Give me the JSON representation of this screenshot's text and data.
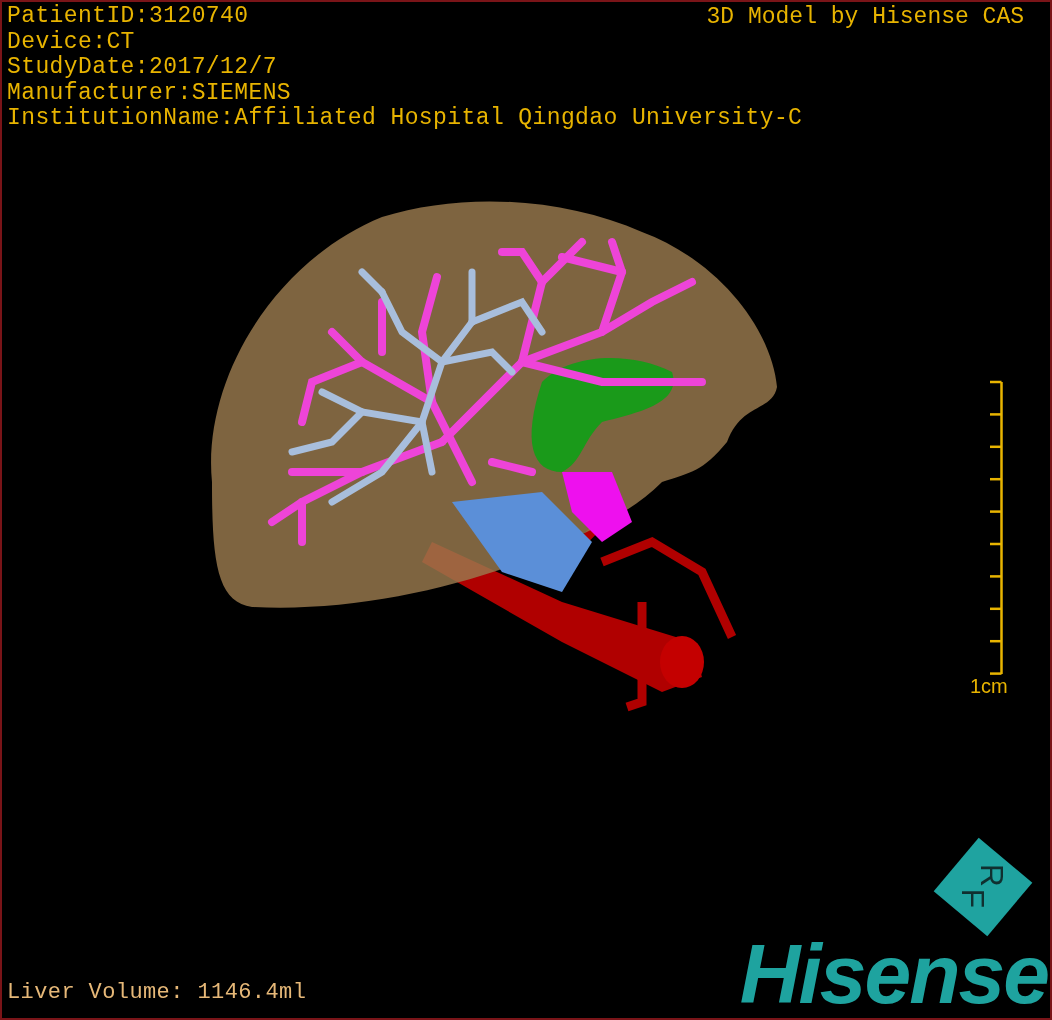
{
  "info_lines": [
    "PatientID:3120740",
    "Device:CT",
    "StudyDate:2017/12/7",
    "Manufacturer:SIEMENS",
    "InstitutionName:Affiliated Hospital Qingdao University-C"
  ],
  "title": "3D Model by Hisense CAS",
  "scale_bar": {
    "label": "1cm"
  },
  "volume": "Liver Volume: 1146.4ml",
  "logo": {
    "badge_letters": [
      "R",
      "F"
    ],
    "wordmark": "Hisense"
  }
}
